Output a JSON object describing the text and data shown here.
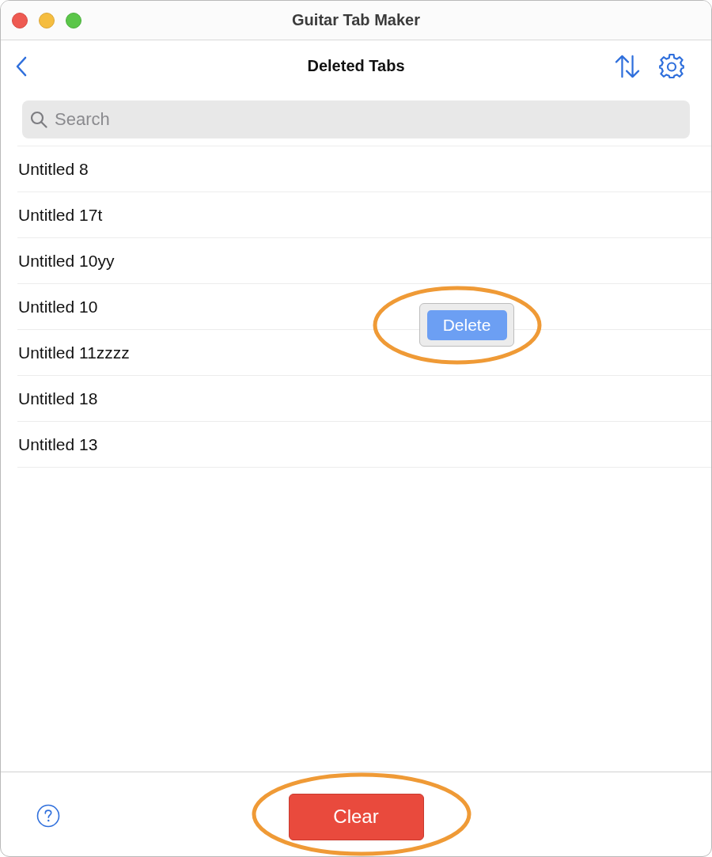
{
  "window": {
    "title": "Guitar Tab Maker"
  },
  "nav_bar": {
    "title": "Deleted Tabs"
  },
  "search": {
    "placeholder": "Search"
  },
  "tabs": [
    {
      "name": "Untitled 8"
    },
    {
      "name": "Untitled 17t"
    },
    {
      "name": "Untitled 10yy"
    },
    {
      "name": "Untitled 10"
    },
    {
      "name": "Untitled 11zzzz"
    },
    {
      "name": "Untitled 18"
    },
    {
      "name": "Untitled 13"
    }
  ],
  "context_menu": {
    "highlighted": true,
    "items": [
      {
        "label": "Delete",
        "selected": true
      }
    ]
  },
  "footer": {
    "clear_button": {
      "label": "Clear",
      "highlighted": true
    }
  }
}
